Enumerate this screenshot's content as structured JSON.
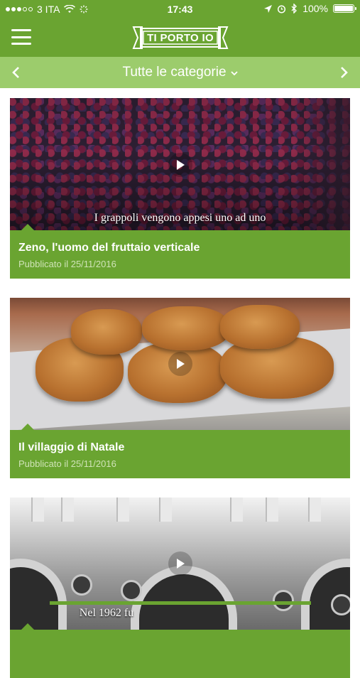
{
  "status_bar": {
    "carrier": "3 ITA",
    "time": "17:43",
    "battery": "100%"
  },
  "header": {
    "logo_text": "TI PORTO IO"
  },
  "category_bar": {
    "label": "Tutte le categorie"
  },
  "cards": [
    {
      "title": "Zeno, l'uomo del fruttaio verticale",
      "date": "Pubblicato il 25/11/2016",
      "video_subtitle": "I grappoli vengono appesi uno ad uno"
    },
    {
      "title": "Il villaggio di Natale",
      "date": "Pubblicato il 25/11/2016",
      "video_subtitle": ""
    },
    {
      "title": "",
      "date": "",
      "video_subtitle": "Nel 1962 fu"
    }
  ],
  "colors": {
    "primary_green": "#6aa431",
    "light_green": "#9ccc6c"
  }
}
